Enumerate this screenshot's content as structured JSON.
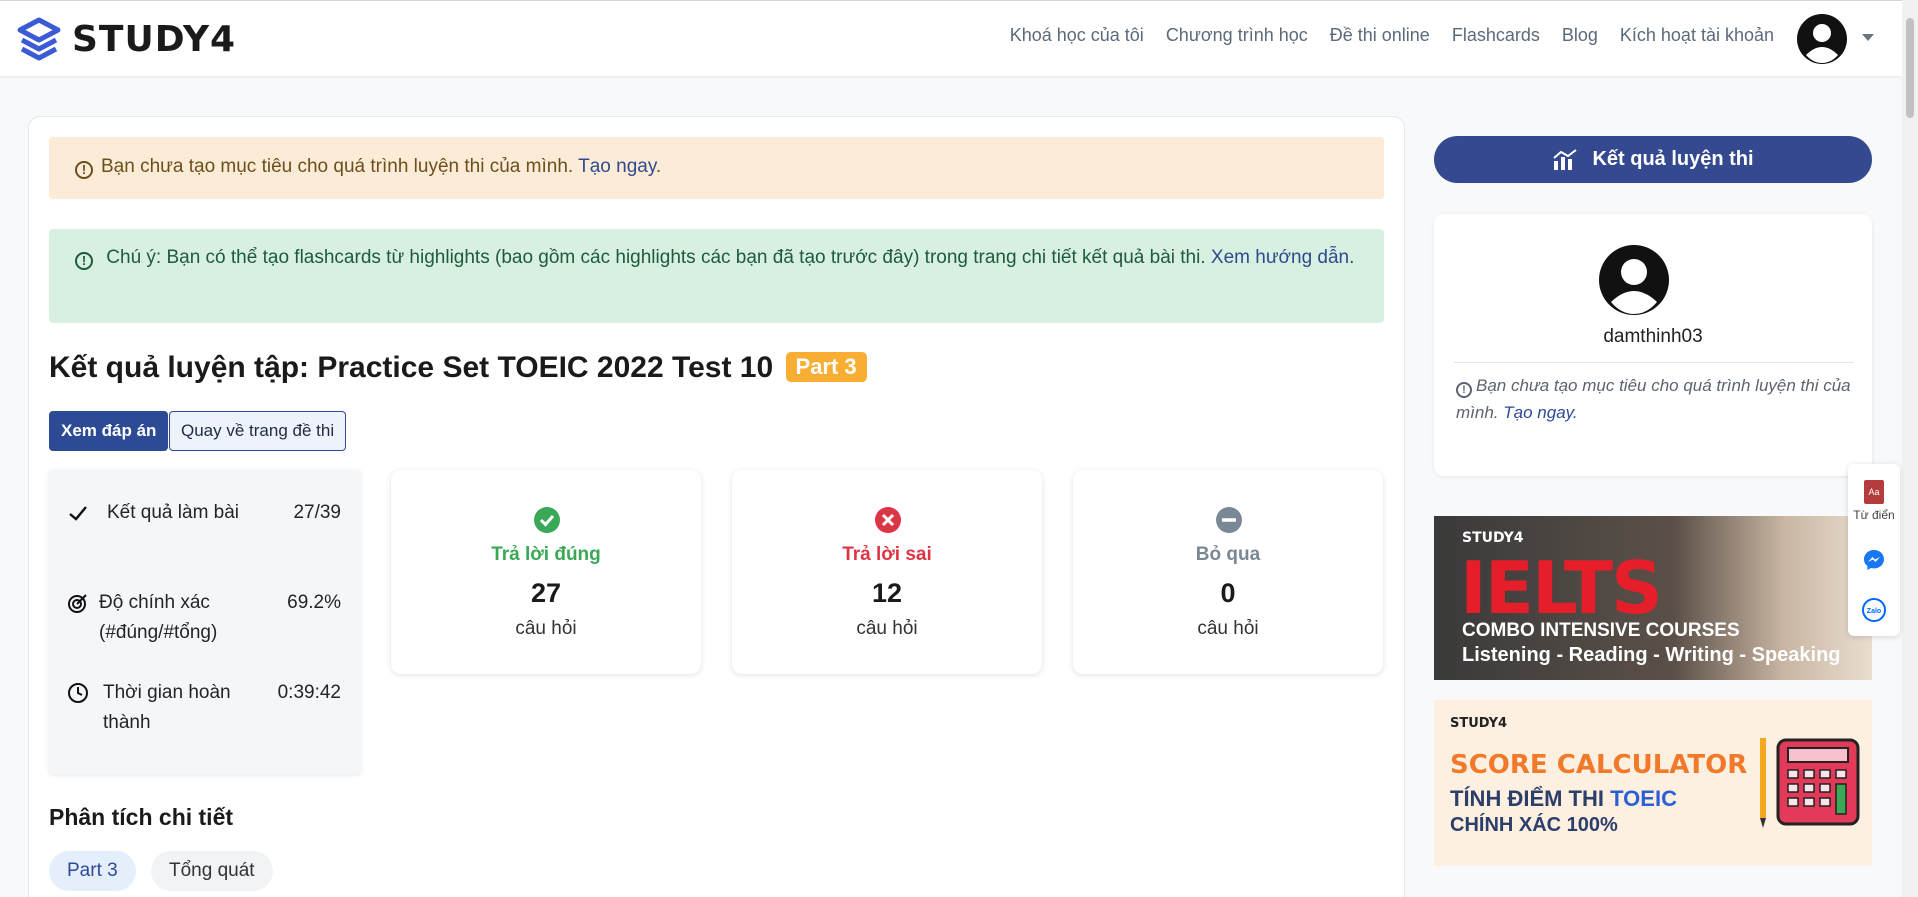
{
  "header": {
    "logo_text": "STUDY4",
    "nav": [
      "Khoá học của tôi",
      "Chương trình học",
      "Đề thi online",
      "Flashcards",
      "Blog",
      "Kích hoạt tài khoản"
    ]
  },
  "alerts": {
    "goal_text": "Bạn chưa tạo mục tiêu cho quá trình luyện thi của mình.",
    "goal_link": "Tạo ngay",
    "note_text": "Chú ý: Bạn có thể tạo flashcards từ highlights (bao gồm các highlights các bạn đã tạo trước đây) trong trang chi tiết kết quả bài thi.",
    "note_link": "Xem hướng dẫn"
  },
  "result": {
    "title": "Kết quả luyện tập: Practice Set TOEIC 2022 Test 10",
    "badge": "Part 3",
    "btn_answers": "Xem đáp án",
    "btn_back": "Quay về trang đề thi"
  },
  "summary": {
    "rows": [
      {
        "label": "Kết quả làm bài",
        "value": "27/39"
      },
      {
        "label": "Độ chính xác (#đúng/#tổng)",
        "value": "69.2%"
      },
      {
        "label": "Thời gian hoàn thành",
        "value": "0:39:42"
      }
    ]
  },
  "stats": [
    {
      "title": "Trả lời đúng",
      "count": "27",
      "unit": "câu hỏi",
      "color": "#3aa856"
    },
    {
      "title": "Trả lời sai",
      "count": "12",
      "unit": "câu hỏi",
      "color": "#dc3545"
    },
    {
      "title": "Bỏ qua",
      "count": "0",
      "unit": "câu hỏi",
      "color": "#7a8895"
    }
  ],
  "analysis": {
    "title": "Phân tích chi tiết",
    "tabs": [
      "Part 3",
      "Tổng quát"
    ]
  },
  "sidebar": {
    "result_button": "Kết quả luyện thi",
    "username": "damthinh03",
    "goal_text": "Bạn chưa tạo mục tiêu cho quá trình luyện thi của mình.",
    "goal_link": "Tạo ngay."
  },
  "banner_ielts": {
    "brand": "STUDY4",
    "headline": "IELTS",
    "line1": "COMBO INTENSIVE COURSES",
    "line2": "Listening - Reading - Writing - Speaking"
  },
  "banner_score": {
    "brand": "STUDY4",
    "headline": "SCORE CALCULATOR",
    "line1_prefix": "TÍNH ĐIỂM THI",
    "line1_highlight": "TOEIC",
    "line2": "CHÍNH XÁC 100%"
  },
  "side_widget": {
    "dictionary_label": "Từ điển"
  },
  "colors": {
    "primary": "#2d4a94",
    "badge": "#f9ad33",
    "warning_bg": "#fcebd6",
    "success_bg": "#d7f0e2"
  }
}
